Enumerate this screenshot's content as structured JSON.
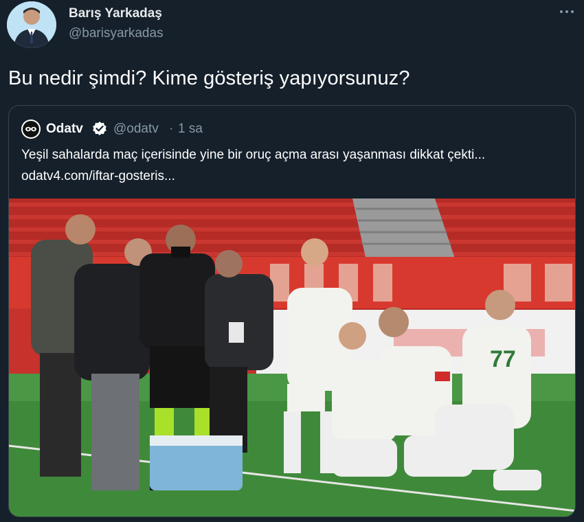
{
  "author": {
    "name": "Barış Yarkadaş",
    "handle": "@barisyarkadas"
  },
  "tweet": {
    "text": "Bu nedir şimdi? Kime gösteriş yapıyorsunuz?"
  },
  "quoted": {
    "name": "Odatv",
    "handle": "@odatv",
    "separator": "·",
    "time": "1 sa",
    "text": "Yeşil sahalarda maç içerisinde yine bir oruç açma arası yaşanması dikkat çekti...",
    "link": "odatv4.com/iftar-gosteris..."
  },
  "photo": {
    "jersey_number": "77",
    "colors": {
      "pitch": "#3f8a3a",
      "seats": "#c0312b",
      "banner": "#d8392f",
      "kit": "#f2f2ee"
    }
  },
  "colors": {
    "background": "#15202b",
    "border": "#38444d",
    "secondary_text": "#8899a6",
    "verified": "#ffffff"
  },
  "icons": {
    "more": "more-horizontal-icon",
    "verified": "verified-badge-icon"
  }
}
